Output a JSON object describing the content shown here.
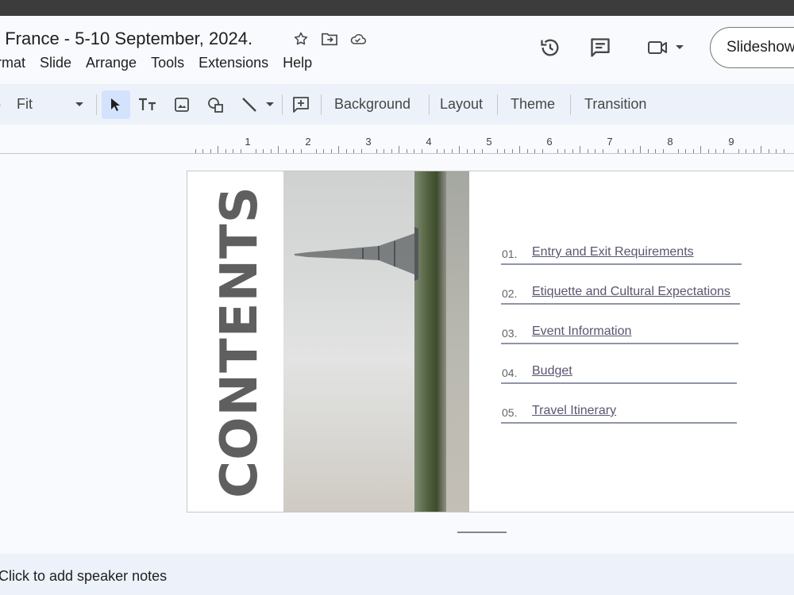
{
  "document": {
    "title": ", France - 5-10 September, 2024.",
    "title_icons": [
      "star-icon",
      "move-to-folder-icon",
      "cloud-saved-icon"
    ]
  },
  "menubar": [
    "rmat",
    "Slide",
    "Arrange",
    "Tools",
    "Extensions",
    "Help"
  ],
  "header_actions": {
    "history_icon": "history-icon",
    "comments_icon": "comment-icon",
    "meet_icon": "video-camera-icon",
    "slideshow_label": "Slideshow"
  },
  "toolbar": {
    "zoom": "Fit",
    "background_label": "Background",
    "layout_label": "Layout",
    "theme_label": "Theme",
    "transition_label": "Transition"
  },
  "ruler": {
    "numbers": [
      "1",
      "2",
      "3",
      "4",
      "5",
      "6",
      "7",
      "8",
      "9"
    ]
  },
  "slide": {
    "heading": "CONTENTS",
    "items": [
      {
        "num": "01.",
        "label": "Entry and Exit Requirements"
      },
      {
        "num": "02.",
        "label": "Etiquette and Cultural Expectations"
      },
      {
        "num": "03.",
        "label": "Event Information"
      },
      {
        "num": "04.",
        "label": "Budget"
      },
      {
        "num": "05.",
        "label": "Travel Itinerary"
      }
    ]
  },
  "notes": {
    "placeholder": "Click to add speaker notes"
  },
  "colors": {
    "accent": "#d3e3fd",
    "toolbar_bg": "#edf2fa",
    "heading_text": "#5f5f5f",
    "link_text": "#5b5570"
  }
}
